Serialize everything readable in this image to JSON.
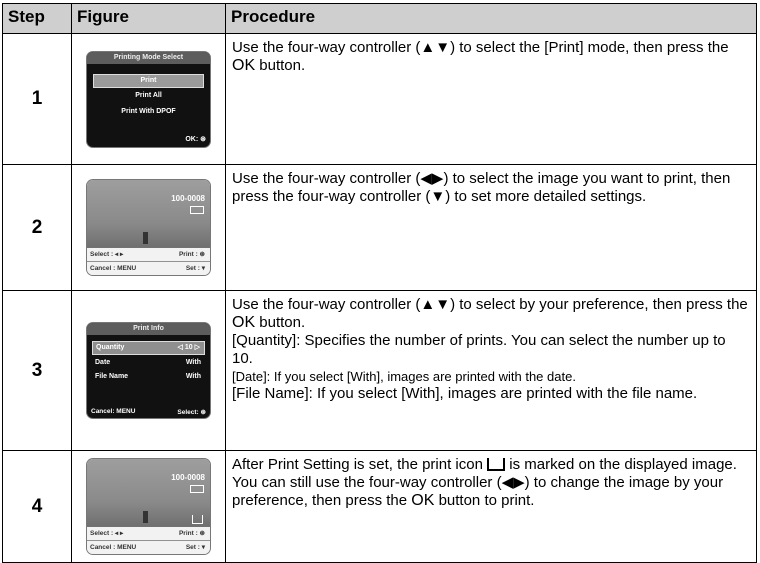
{
  "headers": {
    "step": "Step",
    "figure": "Figure",
    "procedure": "Procedure"
  },
  "rows": [
    {
      "step": "1",
      "screen": {
        "title": "Printing Mode Select",
        "items": [
          "Print",
          "Print All",
          "Print With DPOF"
        ],
        "footer": "OK:"
      },
      "procedure": {
        "pre": "Use the four-way controller (▲▼) to select the [Print] mode, then press the ",
        "ok": "OK",
        "post": " button."
      }
    },
    {
      "step": "2",
      "screen": {
        "file_no": "100-0008",
        "select_label": "Select : ◂ ▸",
        "print_label": "Print :",
        "cancel_label": "Cancel : MENU",
        "set_label": "Set : ▾"
      },
      "procedure": {
        "text": "Use the four-way controller (◀▶) to select the image you want to print, then press the four-way controller (▼) to set more detailed settings."
      }
    },
    {
      "step": "3",
      "screen": {
        "title": "Print Info",
        "rows": [
          {
            "label": "Quantity",
            "value": "◁  10  ▷"
          },
          {
            "label": "Date",
            "value": "With"
          },
          {
            "label": "File Name",
            "value": "With"
          }
        ],
        "cancel_label": "Cancel: MENU",
        "select_label": "Select:"
      },
      "procedure": {
        "pre": "Use the four-way controller (▲▼) to select by your preference, then press the ",
        "ok": "OK",
        "post": " button.",
        "quantity": "[Quantity]: Specifies the number of prints. You can select the number up to 10.",
        "date": "[Date]: If you select [With], images are printed with the date.",
        "filename": "[File Name]: If you select [With], images are printed with the file name."
      }
    },
    {
      "step": "4",
      "screen": {
        "file_no": "100-0008",
        "select_label": "Select : ◂ ▸",
        "print_label": "Print :",
        "cancel_label": "Cancel : MENU",
        "set_label": "Set : ▾"
      },
      "procedure": {
        "pre": "After Print Setting is set, the print icon ",
        "mid": " is marked on the displayed image. You can still use the four-way controller (◀▶) to change the image by your preference, then press the ",
        "ok": "OK",
        "post": " button to print."
      }
    }
  ]
}
